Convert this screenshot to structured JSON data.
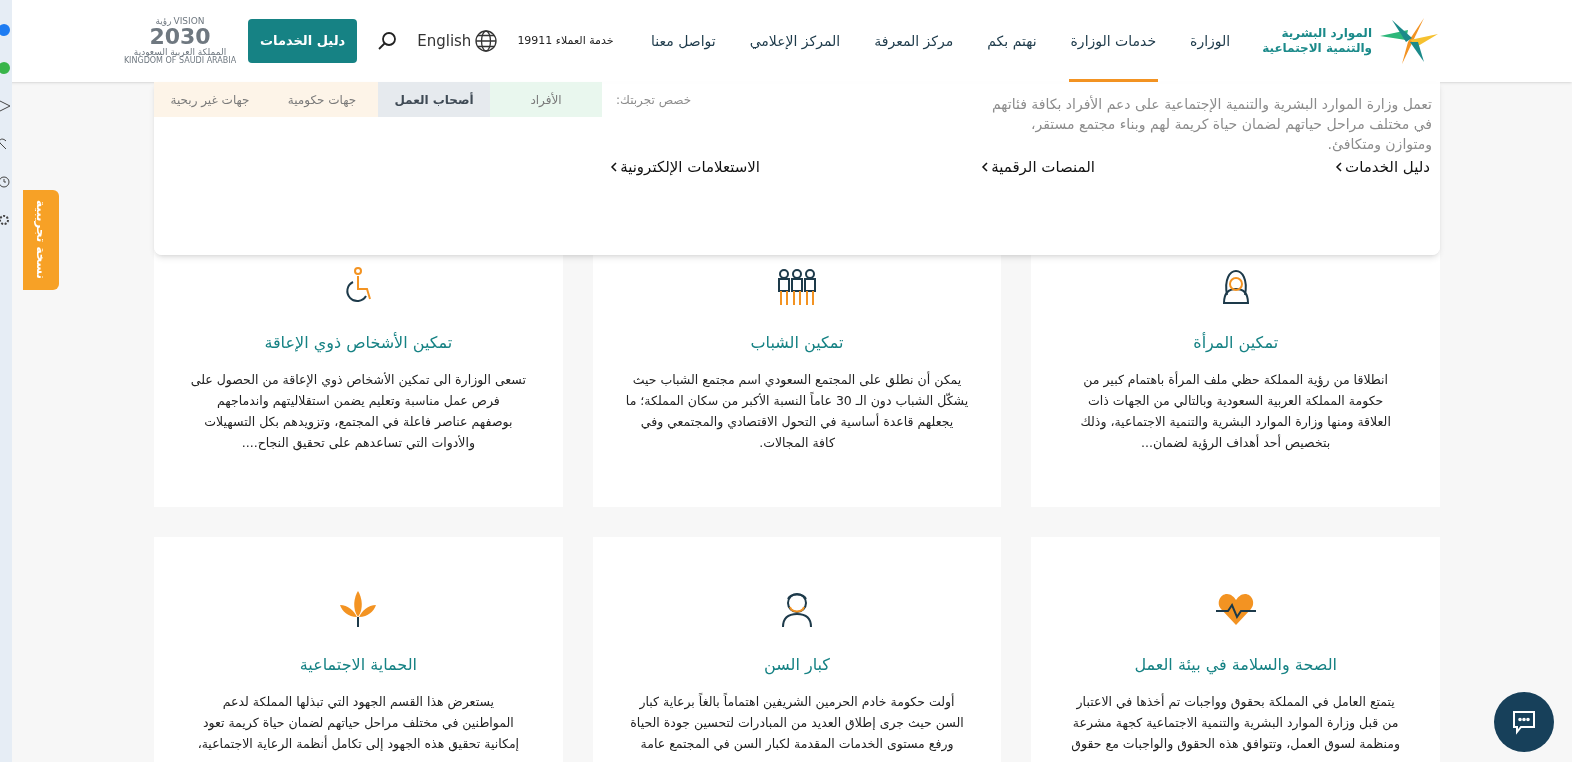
{
  "beta_tab": {
    "label": "نسخة تجريبية"
  },
  "header": {
    "logo_lines": [
      "الموارد البشرية",
      "والتنمية الاجتماعية"
    ],
    "nav": [
      {
        "label": "الوزارة",
        "selected": false
      },
      {
        "label": "خدمات الوزارة",
        "selected": true
      },
      {
        "label": "نهتم بكم",
        "selected": false
      },
      {
        "label": "مركز المعرفة",
        "selected": false
      },
      {
        "label": "المركز الإعلامي",
        "selected": false
      },
      {
        "label": "تواصل معنا",
        "selected": false
      }
    ],
    "customer_service": "خدمة العملاء 19911",
    "language": "English",
    "services_button": "دليل الخدمات",
    "vision_logo": {
      "arabic": "رؤية",
      "latin": "VISION",
      "year": "2030",
      "country_ar": "المملكة العربية السعودية",
      "country_en": "KINGDOM OF SAUDI ARABIA"
    }
  },
  "background_intro": {
    "lines": [
      "تعمل وزارة الموارد البشرية والتنمية الإجتماعية على دعم الأفراد بكافة فئاتهم",
      "في مختلف مراحل حياتهم لضمان حياة كريمة لهم وبناء مجتمع مستقر،",
      "ومتوازن ومتكافئ."
    ],
    "audience_label": "خصص تجربتك:",
    "audience_tabs": [
      {
        "label": "الأفراد",
        "selected": false,
        "color": "#e9f7ee"
      },
      {
        "label": "أصحاب العمل",
        "selected": true,
        "color": "#e6eaee"
      },
      {
        "label": "جهات حكومية",
        "selected": false,
        "color": "#fdf4e8"
      },
      {
        "label": "جهات غير ربحية",
        "selected": false,
        "color": "#fdf4e8"
      }
    ]
  },
  "dropdown": {
    "links": [
      "دليل الخدمات",
      "المنصات الرقمية",
      "الاستعلامات الإلكترونية"
    ]
  },
  "cards": [
    {
      "title": "تمكين المرأة",
      "lines": [
        "انطلاقا من رؤية المملكة حظي ملف المرأة باهتمام كبير من",
        "حكومة المملكة العربية السعودية وبالتالي من الجهات ذات",
        "العلاقة ومنها وزارة الموارد البشرية والتنمية الاجتماعية، وذلك",
        "بتخصيص أحد أهداف الرؤية لضمان..."
      ]
    },
    {
      "title": "تمكين الشباب",
      "lines": [
        "يمكن أن نطلق على المجتمع السعودي اسم مجتمع الشباب حيث",
        "يشكّل الشباب دون الـ 30 عاماً النسبة الأكبر من سكان المملكة؛ ما",
        "يجعلهم قاعدة أساسية في التحول الاقتصادي والمجتمعي وفي",
        "كافة المجالات."
      ]
    },
    {
      "title": "تمكين الأشخاص ذوي الإعاقة",
      "lines": [
        "تسعى الوزارة الى تمكين الأشخاص ذوي الإعاقة من الحصول على",
        "فرص عمل مناسبة وتعليم يضمن استقلاليتهم واندماجهم",
        "بوصفهم عناصر فاعلة في المجتمع، وتزويدهم بكل التسهيلات",
        "والأدوات التي تساعدهم على تحقيق النجاح...."
      ]
    },
    {
      "title": "الصحة والسلامة في بيئة العمل",
      "lines": [
        "يتمتع العامل في المملكة بحقوق وواجبات تم أخذها في الاعتبار",
        "من قبل وزارة الموارد البشرية والتنمية الاجتماعية كجهة مشرعة",
        "ومنظمة لسوق العمل، وتتوافق هذه الحقوق والواجبات مع حقوق"
      ]
    },
    {
      "title": "كبار السن",
      "lines": [
        "أولت حكومة خادم الحرمين الشريفين اهتماماً بالغاً برعاية كبار",
        "السن حيث جرى إطلاق العديد من المبادرات لتحسين جودة الحياة",
        "ورفع مستوى الخدمات المقدمة لكبار السن في المجتمع عامة"
      ]
    },
    {
      "title": "الحماية الاجتماعية",
      "lines": [
        "يستعرض هذا القسم الجهود التي تبذلها المملكة لدعم",
        "المواطنين في مختلف مراحل حياتهم لضمان حياة كريمة تعود",
        "إمكانية تحقيق هذه الجهود إلى تكامل أنظمة الرعاية الاجتماعية،"
      ]
    }
  ]
}
